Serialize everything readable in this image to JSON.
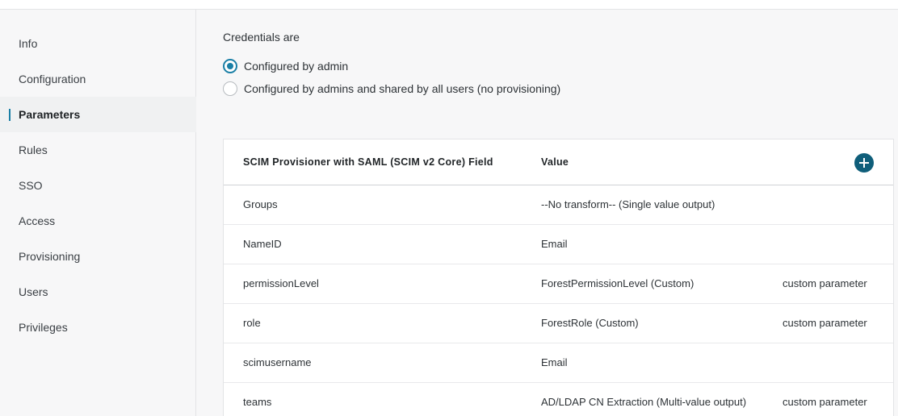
{
  "sidebar": {
    "items": [
      {
        "label": "Info"
      },
      {
        "label": "Configuration"
      },
      {
        "label": "Parameters",
        "active": true
      },
      {
        "label": "Rules"
      },
      {
        "label": "SSO"
      },
      {
        "label": "Access"
      },
      {
        "label": "Provisioning"
      },
      {
        "label": "Users"
      },
      {
        "label": "Privileges"
      }
    ]
  },
  "credentials": {
    "title": "Credentials are",
    "options": [
      {
        "label": "Configured by admin",
        "selected": true
      },
      {
        "label": "Configured by admins and shared by all users (no provisioning)",
        "selected": false
      }
    ]
  },
  "table": {
    "headers": {
      "field": "SCIM Provisioner with SAML (SCIM v2 Core) Field",
      "value": "Value"
    },
    "add_icon": "plus-icon",
    "rows": [
      {
        "field": "Groups",
        "value": "--No transform-- (Single value output)",
        "note": ""
      },
      {
        "field": "NameID",
        "value": "Email",
        "note": ""
      },
      {
        "field": "permissionLevel",
        "value": "ForestPermissionLevel (Custom)",
        "note": "custom parameter"
      },
      {
        "field": "role",
        "value": "ForestRole (Custom)",
        "note": "custom parameter"
      },
      {
        "field": "scimusername",
        "value": "Email",
        "note": ""
      },
      {
        "field": "teams",
        "value": "AD/LDAP CN Extraction (Multi-value output)",
        "note": "custom parameter"
      }
    ]
  },
  "colors": {
    "accent": "#1a7fa6",
    "add_button": "#0f5e7a",
    "background": "#f7f7f8"
  }
}
